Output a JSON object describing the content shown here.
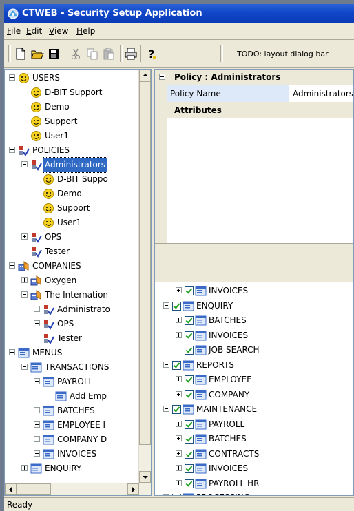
{
  "window": {
    "title": "CTWEB - Security Setup Application"
  },
  "menu": [
    {
      "accel": "F",
      "rest": "ile"
    },
    {
      "accel": "E",
      "rest": "dit"
    },
    {
      "accel": "V",
      "rest": "iew"
    },
    {
      "accel": "H",
      "rest": "elp"
    }
  ],
  "toolbar": {
    "icons": [
      "new-icon",
      "open-icon",
      "save-icon",
      "cut-icon",
      "copy-icon",
      "paste-icon",
      "print-icon",
      "help-icon"
    ],
    "dialog_bar_text": "TODO: layout dialog bar"
  },
  "left_tree": [
    {
      "label": "USERS",
      "icon": "user-icon",
      "exp": "minus"
    },
    {
      "label": "D-BIT Support",
      "icon": "user-icon"
    },
    {
      "label": "Demo",
      "icon": "user-icon"
    },
    {
      "label": "Support",
      "icon": "user-icon"
    },
    {
      "label": "User1",
      "icon": "user-icon"
    },
    {
      "label": "POLICIES",
      "icon": "policy-icon",
      "exp": "minus"
    },
    {
      "label": "Administrators",
      "icon": "policy-icon",
      "exp": "minus",
      "selected": true
    },
    {
      "label": "D-BIT Suppo",
      "icon": "user-icon"
    },
    {
      "label": "Demo",
      "icon": "user-icon"
    },
    {
      "label": "Support",
      "icon": "user-icon"
    },
    {
      "label": "User1",
      "icon": "user-icon"
    },
    {
      "label": "OPS",
      "icon": "policy-icon",
      "exp": "plus"
    },
    {
      "label": "Tester",
      "icon": "policy-icon"
    },
    {
      "label": "COMPANIES",
      "icon": "company-icon",
      "exp": "minus"
    },
    {
      "label": "Oxygen",
      "icon": "company-icon",
      "exp": "plus"
    },
    {
      "label": "The Internation",
      "icon": "company-icon",
      "exp": "minus"
    },
    {
      "label": "Administrato",
      "icon": "policy-icon",
      "exp": "plus"
    },
    {
      "label": "OPS",
      "icon": "policy-icon",
      "exp": "plus"
    },
    {
      "label": "Tester",
      "icon": "policy-icon"
    },
    {
      "label": "MENUS",
      "icon": "menu-icon",
      "exp": "minus"
    },
    {
      "label": "TRANSACTIONS",
      "icon": "menu-icon",
      "exp": "minus"
    },
    {
      "label": "PAYROLL",
      "icon": "menu-icon",
      "exp": "minus"
    },
    {
      "label": "Add Emp",
      "icon": "menu-icon"
    },
    {
      "label": "BATCHES",
      "icon": "menu-icon",
      "exp": "plus"
    },
    {
      "label": "EMPLOYEE I",
      "icon": "menu-icon",
      "exp": "plus"
    },
    {
      "label": "COMPANY D",
      "icon": "menu-icon",
      "exp": "plus"
    },
    {
      "label": "INVOICES",
      "icon": "menu-icon",
      "exp": "plus"
    },
    {
      "label": "ENQUIRY",
      "icon": "menu-icon",
      "exp": "plus"
    }
  ],
  "property_grid": {
    "header": "Policy : Administrators",
    "row_name": "Policy Name",
    "row_value": "Administrators",
    "section": "Attributes"
  },
  "right_tree": [
    {
      "label": "INVOICES",
      "exp": "plus"
    },
    {
      "label": "ENQUIRY",
      "exp": "minus"
    },
    {
      "label": "BATCHES",
      "exp": "plus"
    },
    {
      "label": "INVOICES",
      "exp": "plus"
    },
    {
      "label": "JOB SEARCH"
    },
    {
      "label": "REPORTS",
      "exp": "minus"
    },
    {
      "label": "EMPLOYEE",
      "exp": "plus"
    },
    {
      "label": "COMPANY",
      "exp": "plus"
    },
    {
      "label": "MAINTENANCE",
      "exp": "minus"
    },
    {
      "label": "PAYROLL",
      "exp": "plus"
    },
    {
      "label": "BATCHES",
      "exp": "plus"
    },
    {
      "label": "CONTRACTS",
      "exp": "plus"
    },
    {
      "label": "INVOICES",
      "exp": "plus"
    },
    {
      "label": "PAYROLL HR",
      "exp": "plus"
    },
    {
      "label": "PROCESSING",
      "exp": "plus"
    }
  ],
  "status": {
    "text": "Ready"
  }
}
